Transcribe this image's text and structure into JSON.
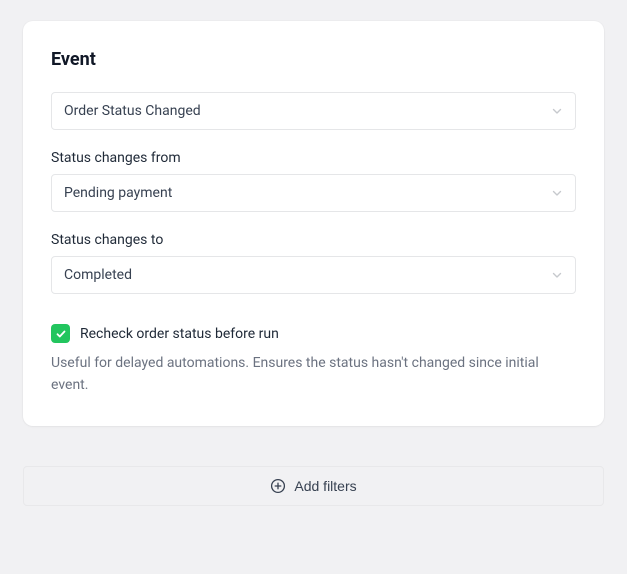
{
  "card": {
    "title": "Event",
    "eventSelect": {
      "value": "Order Status Changed"
    },
    "fromLabel": "Status changes from",
    "fromSelect": {
      "value": "Pending payment"
    },
    "toLabel": "Status changes to",
    "toSelect": {
      "value": "Completed"
    },
    "recheck": {
      "checked": true,
      "label": "Recheck order status before run",
      "help": "Useful for delayed automations. Ensures the status hasn't changed since initial event."
    }
  },
  "addFilters": {
    "label": "Add filters"
  }
}
